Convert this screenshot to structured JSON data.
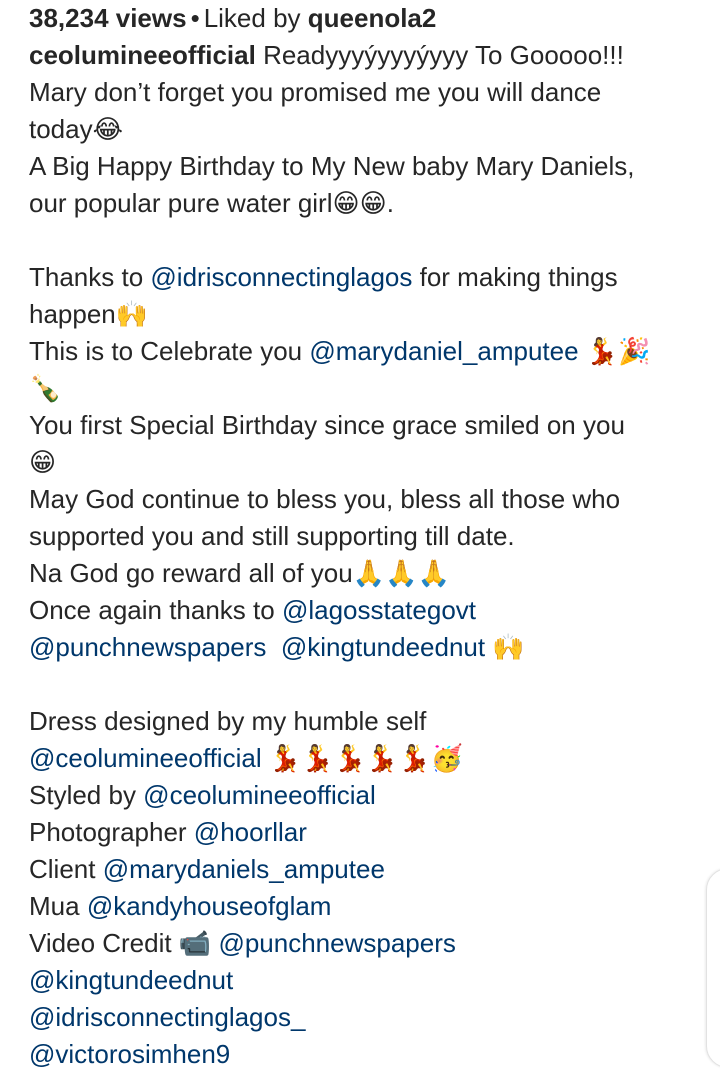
{
  "stats": {
    "views": "38,234 views",
    "separator": "•",
    "liked_by_prefix": "Liked by",
    "liked_by_user": "queenola2"
  },
  "caption": {
    "author": "ceolumineeofficial",
    "l1_text": " Readyyyýyyyýyyy To Gooooo!!!",
    "l2": "Mary don’t forget you promised me you will dance",
    "l3": "today😂",
    "l4": "A Big Happy Birthday to My New baby Mary Daniels,",
    "l5": "our popular pure water girl😁😁.",
    "l7_a": "Thanks to ",
    "l7_m": "@idrisconnectinglagos",
    "l7_b": " for making things",
    "l8": "happen🙌",
    "l9_a": "This is to Celebrate you ",
    "l9_m": "@marydaniel_amputee",
    "l9_b": " 💃🎉",
    "l10": "🍾",
    "l11": "You first Special Birthday since grace smiled on you",
    "l12": "😁",
    "l13": "May God continue to bless you, bless all those who",
    "l14": "supported you and still supporting till date.",
    "l15": "Na God go reward all of you🙏🙏🙏",
    "l16_a": "Once again thanks to ",
    "l16_m": "@lagosstategovt",
    "l17_m1": "@punchnewspapers",
    "l17_m2": "@kingtundeednut",
    "l17_e": " 🙌",
    "l19": "Dress designed by my humble self",
    "l20_m": "@ceolumineeofficial",
    "l20_e": " 💃💃💃💃💃🥳",
    "l21_a": "Styled by ",
    "l21_m": "@ceolumineeofficial",
    "l22_a": "Photographer ",
    "l22_m": "@hoorllar",
    "l23_a": "Client ",
    "l23_m": "@marydaniels_amputee",
    "l24_a": "Mua ",
    "l24_m": "@kandyhouseofglam",
    "l25_a": "Video Credit 📹 ",
    "l25_m": "@punchnewspapers",
    "l26_m": "@kingtundeednut",
    "l27_m": "@idrisconnectinglagos_",
    "l28_m": "@victorosimhen9"
  },
  "colors": {
    "text": "#262626",
    "mention": "#00376b",
    "background": "#ffffff"
  }
}
